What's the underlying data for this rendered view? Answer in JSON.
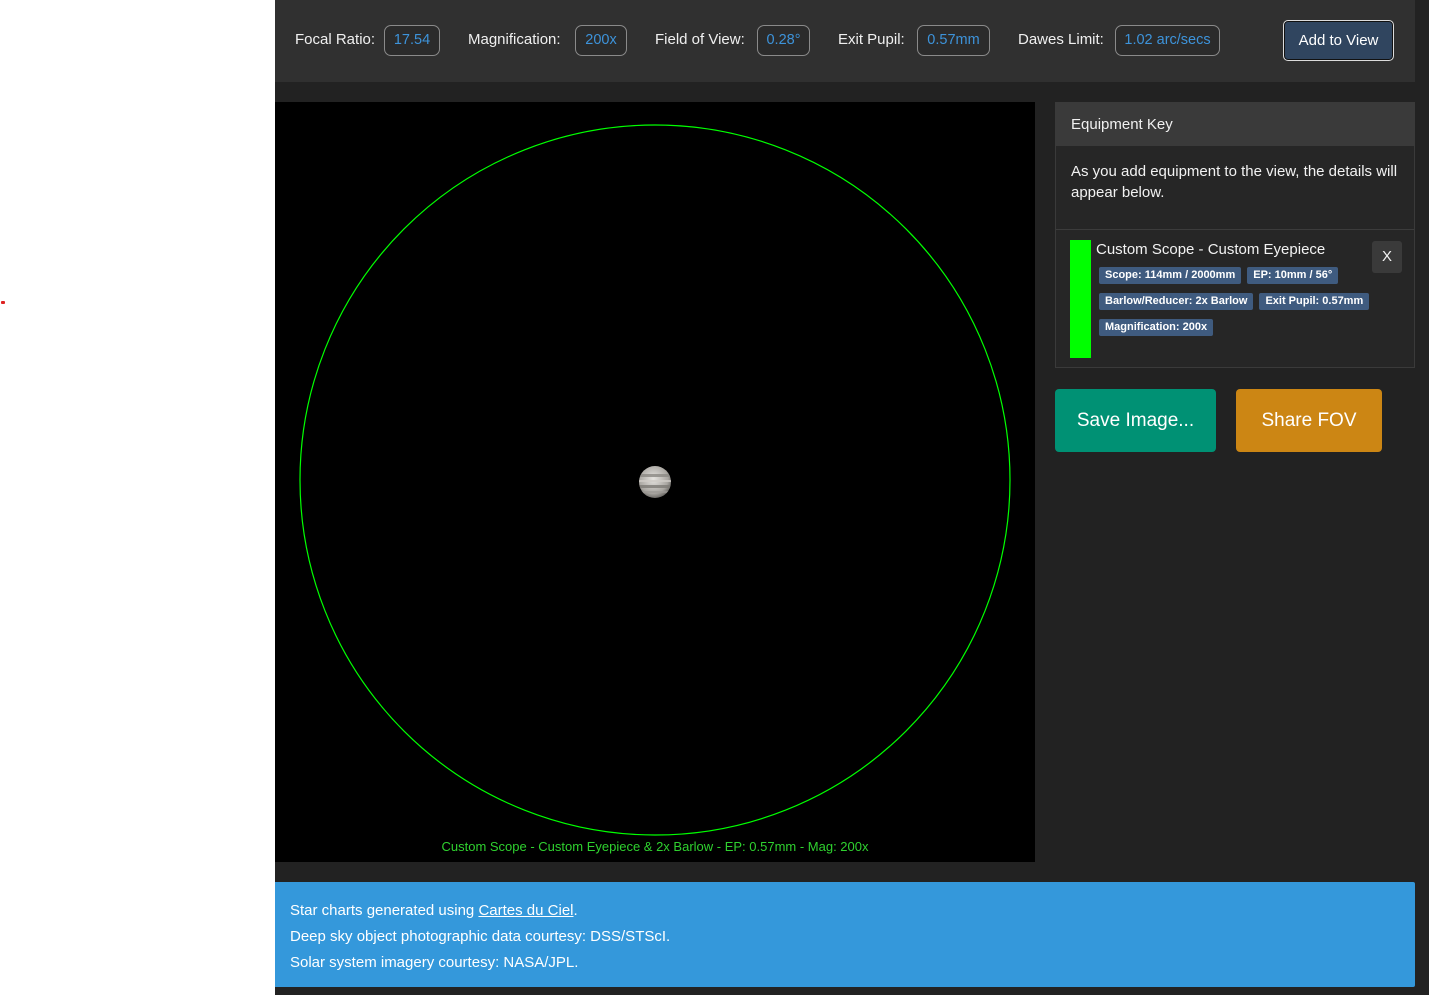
{
  "stats": {
    "focal_ratio_label": "Focal Ratio:",
    "focal_ratio_value": "17.54",
    "magnification_label": "Magnification:",
    "magnification_value": "200x",
    "fov_label": "Field of View:",
    "fov_value": "0.28°",
    "exit_pupil_label": "Exit Pupil:",
    "exit_pupil_value": "0.57mm",
    "dawes_label": "Dawes Limit:",
    "dawes_value": "1.02 arc/secs",
    "add_button": "Add to View"
  },
  "view": {
    "caption": "Custom Scope - Custom Eyepiece & 2x Barlow - EP: 0.57mm - Mag: 200x",
    "circle_color": "#00ff00",
    "object_icon": "jupiter-planet"
  },
  "equipment_key": {
    "header": "Equipment Key",
    "intro": "As you add equipment to the view, the details will appear below.",
    "item": {
      "title": "Custom Scope - Custom Eyepiece",
      "color": "#00ff00",
      "close_label": "X",
      "badges": [
        "Scope: 114mm / 2000mm",
        "EP: 10mm / 56°",
        "Barlow/Reducer: 2x Barlow",
        "Exit Pupil: 0.57mm",
        "Magnification: 200x"
      ]
    }
  },
  "actions": {
    "save_label": "Save Image...",
    "share_label": "Share FOV"
  },
  "credits": {
    "line1_prefix": "Star charts generated using ",
    "line1_link": "Cartes du Ciel",
    "line1_suffix": ".",
    "line2": "Deep sky object photographic data courtesy: DSS/STScI.",
    "line3": "Solar system imagery courtesy: NASA/JPL."
  },
  "colors": {
    "panel_bg": "#222222",
    "stat_value": "#3d93da",
    "save_button": "#009174",
    "share_button": "#cc8614",
    "credits_bg": "#3498db",
    "badge_bg": "#3f5b7f"
  }
}
